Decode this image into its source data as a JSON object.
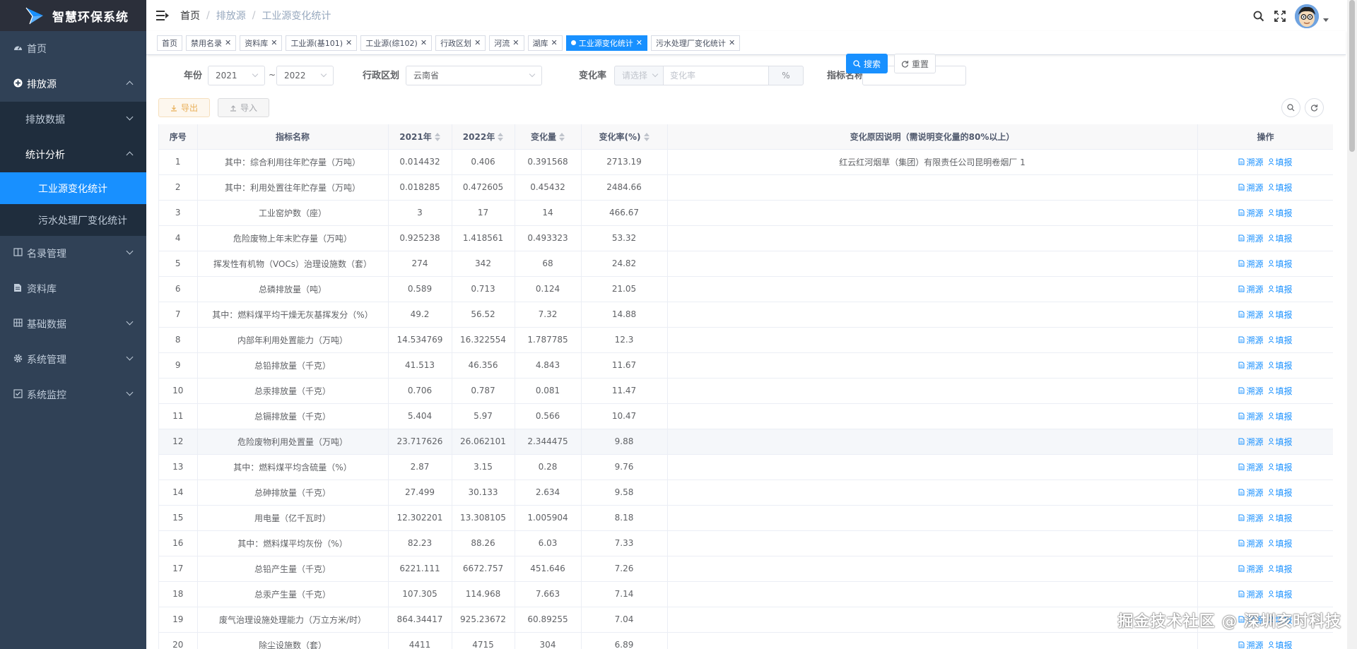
{
  "app": {
    "title": "智慧环保系统"
  },
  "sidebar": {
    "items": [
      {
        "label": "首页",
        "icon": "dashboard-icon"
      },
      {
        "label": "排放源",
        "icon": "plus-circle-icon"
      },
      {
        "label": "排放数据"
      },
      {
        "label": "统计分析"
      },
      {
        "label": "工业源变化统计"
      },
      {
        "label": "污水处理厂变化统计"
      },
      {
        "label": "名录管理",
        "icon": "book-icon"
      },
      {
        "label": "资料库",
        "icon": "document-icon"
      },
      {
        "label": "基础数据",
        "icon": "grid-icon"
      },
      {
        "label": "系统管理",
        "icon": "gear-icon"
      },
      {
        "label": "系统监控",
        "icon": "monitor-icon"
      }
    ]
  },
  "breadcrumb": [
    "首页",
    "排放源",
    "工业源变化统计"
  ],
  "tags": [
    {
      "label": "首页",
      "closable": false,
      "active": false
    },
    {
      "label": "禁用名录",
      "closable": true,
      "active": false
    },
    {
      "label": "资料库",
      "closable": true,
      "active": false
    },
    {
      "label": "工业源(基101)",
      "closable": true,
      "active": false
    },
    {
      "label": "工业源(综102)",
      "closable": true,
      "active": false
    },
    {
      "label": "行政区划",
      "closable": true,
      "active": false
    },
    {
      "label": "河流",
      "closable": true,
      "active": false
    },
    {
      "label": "湖库",
      "closable": true,
      "active": false
    },
    {
      "label": "工业源变化统计",
      "closable": true,
      "active": true
    },
    {
      "label": "污水处理厂变化统计",
      "closable": true,
      "active": false
    }
  ],
  "filter": {
    "year_label": "年份",
    "year_from": "2021",
    "year_to": "2022",
    "year_sep": "~",
    "region_label": "行政区划",
    "region_value": "云南省",
    "rate_label": "变化率",
    "rate_op_placeholder": "请选择",
    "rate_placeholder": "变化率",
    "rate_unit": "%",
    "indicator_label": "指标名称",
    "indicator_value": "",
    "search_label": "搜索",
    "reset_label": "重置"
  },
  "toolbar": {
    "export_label": "导出",
    "import_label": "导入"
  },
  "table": {
    "headers": [
      "序号",
      "指标名称",
      "2021年",
      "2022年",
      "变化量",
      "变化率(%)",
      "变化原因说明（需说明变化量的80%以上）",
      "操作"
    ],
    "op_trace": "溯源",
    "op_fill": "填报",
    "rows": [
      [
        "1",
        "其中：综合利用往年贮存量（万吨）",
        "0.014432",
        "0.406",
        "0.391568",
        "2713.19",
        "红云红河烟草（集团）有限责任公司昆明卷烟厂 1"
      ],
      [
        "2",
        "其中：利用处置往年贮存量（万吨）",
        "0.018285",
        "0.472605",
        "0.45432",
        "2484.66",
        ""
      ],
      [
        "3",
        "工业窑炉数（座）",
        "3",
        "17",
        "14",
        "466.67",
        ""
      ],
      [
        "4",
        "危险废物上年末贮存量（万吨）",
        "0.925238",
        "1.418561",
        "0.493323",
        "53.32",
        ""
      ],
      [
        "5",
        "挥发性有机物（VOCs）治理设施数（套）",
        "274",
        "342",
        "68",
        "24.82",
        ""
      ],
      [
        "6",
        "总磷排放量（吨）",
        "0.589",
        "0.713",
        "0.124",
        "21.05",
        ""
      ],
      [
        "7",
        "其中：燃料煤平均干燥无灰基挥发分（%）",
        "49.2",
        "56.52",
        "7.32",
        "14.88",
        ""
      ],
      [
        "8",
        "内部年利用处置能力（万吨）",
        "14.534769",
        "16.322554",
        "1.787785",
        "12.3",
        ""
      ],
      [
        "9",
        "总铅排放量（千克）",
        "41.513",
        "46.356",
        "4.843",
        "11.67",
        ""
      ],
      [
        "10",
        "总汞排放量（千克）",
        "0.706",
        "0.787",
        "0.081",
        "11.47",
        ""
      ],
      [
        "11",
        "总镉排放量（千克）",
        "5.404",
        "5.97",
        "0.566",
        "10.47",
        ""
      ],
      [
        "12",
        "危险废物利用处置量（万吨）",
        "23.717626",
        "26.062101",
        "2.344475",
        "9.88",
        ""
      ],
      [
        "13",
        "其中：燃料煤平均含硫量（%）",
        "2.87",
        "3.15",
        "0.28",
        "9.76",
        ""
      ],
      [
        "14",
        "总砷排放量（千克）",
        "27.499",
        "30.133",
        "2.634",
        "9.58",
        ""
      ],
      [
        "15",
        "用电量（亿千瓦时）",
        "12.302201",
        "13.308105",
        "1.005904",
        "8.18",
        ""
      ],
      [
        "16",
        "其中：燃料煤平均灰份（%）",
        "82.23",
        "88.26",
        "6.03",
        "7.33",
        ""
      ],
      [
        "17",
        "总铅产生量（千克）",
        "6221.111",
        "6672.757",
        "451.646",
        "7.26",
        ""
      ],
      [
        "18",
        "总汞产生量（千克）",
        "107.305",
        "114.968",
        "7.663",
        "7.14",
        ""
      ],
      [
        "19",
        "废气治理设施处理能力（万立方米/时）",
        "864.34417",
        "925.23672",
        "60.89255",
        "7.04",
        ""
      ],
      [
        "20",
        "除尘设施数（套）",
        "4411",
        "4715",
        "304",
        "6.89",
        ""
      ]
    ]
  },
  "watermark": "掘金技术社区 @ 深圳亥时科技",
  "colors": {
    "sidebar_bg": "#304156",
    "primary": "#1890ff",
    "warning": "#e6a23c"
  }
}
